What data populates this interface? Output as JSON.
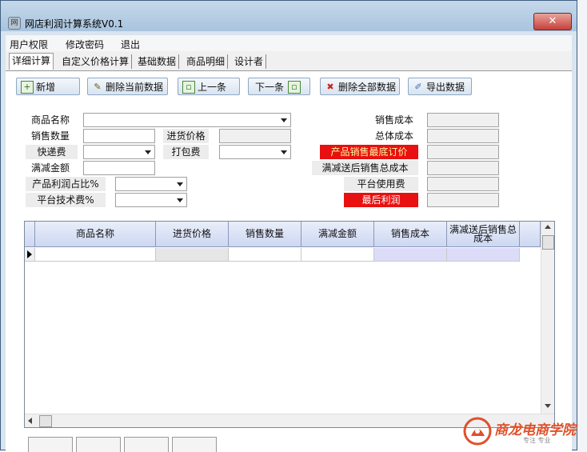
{
  "window": {
    "title": "网店利润计算系统V0.1",
    "close_glyph": "✕"
  },
  "menu": [
    "用户权限",
    "修改密码",
    "退出"
  ],
  "tabs": [
    "详细计算",
    "自定义价格计算",
    "基础数据",
    "商品明细",
    "设计者"
  ],
  "toolbar": {
    "add": "新增",
    "delete_current": "删除当前数据",
    "prev": "上一条",
    "next": "下一条",
    "delete_all": "删除全部数据",
    "export": "导出数据"
  },
  "form": {
    "product_name": "商品名称",
    "sales_qty": "销售数量",
    "purchase_price": "进货价格",
    "express_fee": "快递费",
    "packing_fee": "打包费",
    "discount_amount": "满减金额",
    "profit_ratio": "产品利润占比%",
    "platform_tech_fee": "平台技术费%",
    "sales_cost": "销售成本",
    "total_cost": "总体成本",
    "min_price": "产品销售最底订价",
    "after_discount_total": "满减送后销售总成本",
    "platform_usage_fee": "平台使用费",
    "final_profit": "最后利润"
  },
  "grid": {
    "columns": [
      "商品名称",
      "进货价格",
      "销售数量",
      "满减金额",
      "销售成本",
      "满减送后销售总成本"
    ]
  },
  "colors": {
    "alert_red": "#e81010",
    "alert_text": "#fff8a0",
    "logo": "#e0502a"
  },
  "logo": {
    "name": "商龙电商学院",
    "tagline": "专注 专业"
  }
}
